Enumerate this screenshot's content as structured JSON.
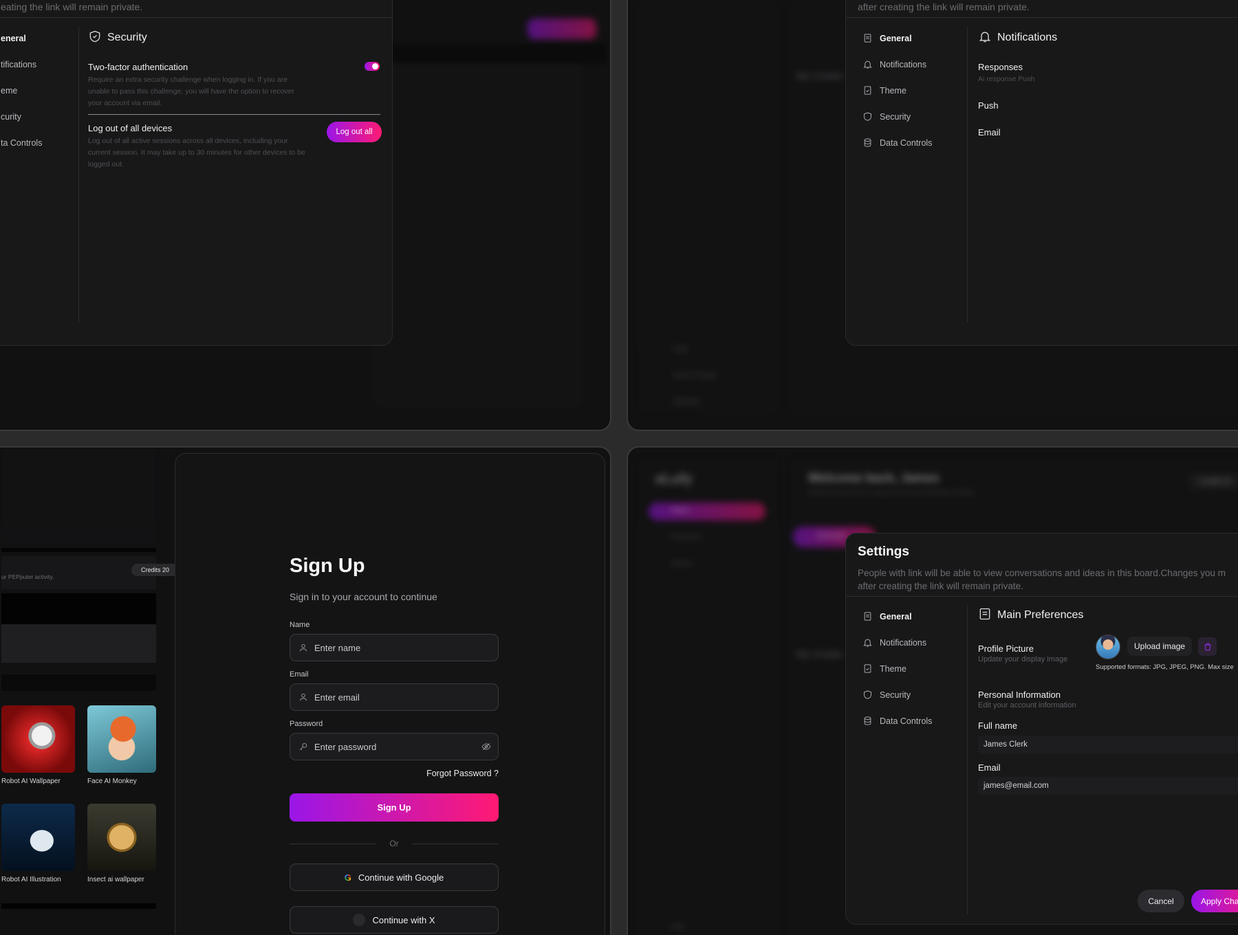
{
  "colors": {
    "accent_start": "#9a16e8",
    "accent_end": "#ff1a73",
    "bg": "#111112",
    "panel": "#181819"
  },
  "security_panel": {
    "header_text": "eating the link will remain private.",
    "sidebar": [
      "eneral",
      "tifications",
      "eme",
      "curity",
      "ta Controls"
    ],
    "title": "Security",
    "title_icon": "shield-icon",
    "two_factor": {
      "label": "Two-factor authentication",
      "desc": "Require an extra security challenge when logging in. If you are unable to pass this challenge, you will have the option to recover your account via email.",
      "enabled": true
    },
    "logout": {
      "label": "Log out of all devices",
      "desc": "Log out of all active sessions across all devices, including your current session. It may take up to 30 minutes for other devices to be logged out.",
      "button": "Log out all"
    },
    "bg_button": "Generate"
  },
  "notifications_panel": {
    "header_text": "after creating the link will remain private.",
    "sidebar": [
      {
        "label": "General",
        "icon": "document-icon",
        "active": true
      },
      {
        "label": "Notifications",
        "icon": "bell-icon",
        "active": false
      },
      {
        "label": "Theme",
        "icon": "theme-icon",
        "active": false
      },
      {
        "label": "Security",
        "icon": "shield-icon",
        "active": false
      },
      {
        "label": "Data Controls",
        "icon": "database-icon",
        "active": false
      }
    ],
    "title": "Notifications",
    "rows": [
      {
        "label": "Responses",
        "desc": "Ai response Push"
      },
      {
        "label": "Push",
        "desc": ""
      },
      {
        "label": "Email",
        "desc": ""
      }
    ],
    "bg_label": "My Creatio",
    "bg_menu": [
      "Help",
      "Invite People",
      "Settings"
    ]
  },
  "gallery_panel": {
    "sub_text": "ur PEPputer activity.",
    "credits": "Credits 20",
    "items": [
      {
        "caption": "Robot AI Wallpaper"
      },
      {
        "caption": "Face AI Monkey"
      },
      {
        "caption": "Robot AI Illustration"
      },
      {
        "caption": "Insect ai wallpaper"
      }
    ]
  },
  "signup": {
    "title": "Sign Up",
    "subtitle": "Sign in to your account to continue",
    "name_label": "Name",
    "name_placeholder": "Enter name",
    "email_label": "Email",
    "email_placeholder": "Enter email",
    "password_label": "Password",
    "password_placeholder": "Enter password",
    "forgot": "Forgot Password ?",
    "submit": "Sign Up",
    "or": "Or",
    "google": "Continue with Google",
    "x": "Continue with X"
  },
  "settings_panel": {
    "brand": "eLufy",
    "bg_welcome": "Welcome back, James",
    "bg_welcome_sub": "Welcome back! Here's a quick look at your PEPputer activity",
    "bg_credits": "Credits 20",
    "bg_nav": [
      "Home",
      "Inspiration",
      "History"
    ],
    "bg_tab": "Generate",
    "bg_label": "My Creatio",
    "bg_help": "Help",
    "title": "Settings",
    "description": "People with link will be able to view conversations and ideas in this board.Changes you m after creating the link will remain private.",
    "sidebar": [
      {
        "label": "General",
        "icon": "document-icon",
        "active": true
      },
      {
        "label": "Notifications",
        "icon": "bell-icon",
        "active": false
      },
      {
        "label": "Theme",
        "icon": "theme-icon",
        "active": false
      },
      {
        "label": "Security",
        "icon": "shield-icon",
        "active": false
      },
      {
        "label": "Data Controls",
        "icon": "database-icon",
        "active": false
      }
    ],
    "section_title": "Main Preferences",
    "profile": {
      "label": "Profile Picture",
      "desc": "Update your display image",
      "upload": "Upload image",
      "formats": "Supported formats: JPG, JPEG, PNG. Max size"
    },
    "personal": {
      "label": "Personal Information",
      "desc": "Edit your account information"
    },
    "full_name_label": "Full name",
    "full_name_value": "James Clerk",
    "email_label": "Email",
    "email_value": "james@email.com",
    "cancel": "Cancel",
    "apply": "Apply Cha"
  }
}
